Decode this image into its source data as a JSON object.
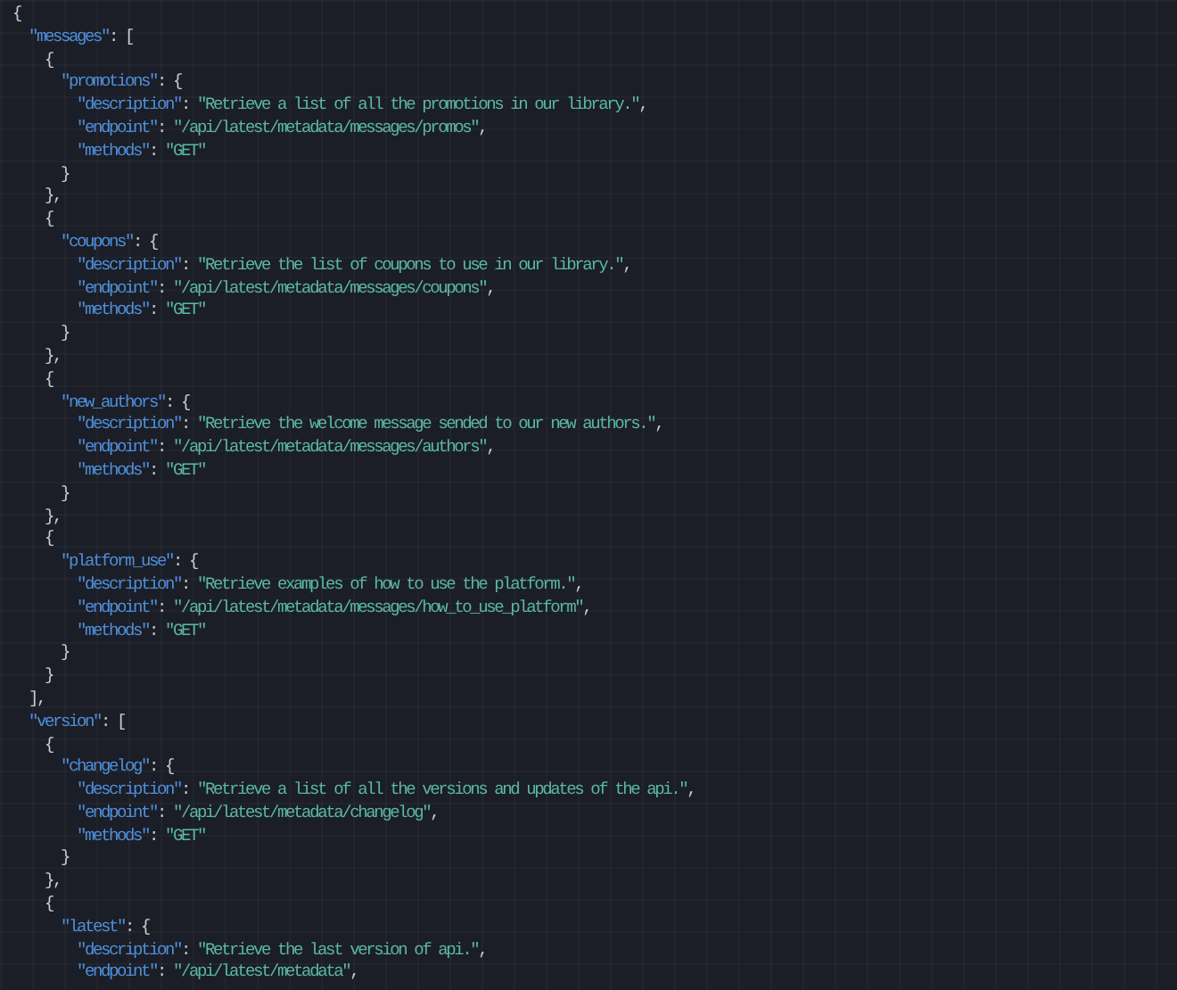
{
  "editor": {
    "lines": [
      [
        {
          "kind": "punct",
          "text": "{"
        }
      ],
      [
        {
          "kind": "key",
          "text": "  \"messages\""
        },
        {
          "kind": "punct",
          "text": ": ["
        }
      ],
      [
        {
          "kind": "punct",
          "text": "    {"
        }
      ],
      [
        {
          "kind": "key",
          "text": "      \"promotions\""
        },
        {
          "kind": "punct",
          "text": ": {"
        }
      ],
      [
        {
          "kind": "key",
          "text": "        \"description\""
        },
        {
          "kind": "punct",
          "text": ": "
        },
        {
          "kind": "string",
          "text": "\"Retrieve a list of all the promotions in our library.\""
        },
        {
          "kind": "punct",
          "text": ","
        }
      ],
      [
        {
          "kind": "key",
          "text": "        \"endpoint\""
        },
        {
          "kind": "punct",
          "text": ": "
        },
        {
          "kind": "string",
          "text": "\"/api/latest/metadata/messages/promos\""
        },
        {
          "kind": "punct",
          "text": ","
        }
      ],
      [
        {
          "kind": "key",
          "text": "        \"methods\""
        },
        {
          "kind": "punct",
          "text": ": "
        },
        {
          "kind": "string",
          "text": "\"GET\""
        }
      ],
      [
        {
          "kind": "punct",
          "text": "      }"
        }
      ],
      [
        {
          "kind": "punct",
          "text": "    },"
        }
      ],
      [
        {
          "kind": "punct",
          "text": "    {"
        }
      ],
      [
        {
          "kind": "key",
          "text": "      \"coupons\""
        },
        {
          "kind": "punct",
          "text": ": {"
        }
      ],
      [
        {
          "kind": "key",
          "text": "        \"description\""
        },
        {
          "kind": "punct",
          "text": ": "
        },
        {
          "kind": "string",
          "text": "\"Retrieve the list of coupons to use in our library.\""
        },
        {
          "kind": "punct",
          "text": ","
        }
      ],
      [
        {
          "kind": "key",
          "text": "        \"endpoint\""
        },
        {
          "kind": "punct",
          "text": ": "
        },
        {
          "kind": "string",
          "text": "\"/api/latest/metadata/messages/coupons\""
        },
        {
          "kind": "punct",
          "text": ","
        }
      ],
      [
        {
          "kind": "key",
          "text": "        \"methods\""
        },
        {
          "kind": "punct",
          "text": ": "
        },
        {
          "kind": "string",
          "text": "\"GET\""
        }
      ],
      [
        {
          "kind": "punct",
          "text": "      }"
        }
      ],
      [
        {
          "kind": "punct",
          "text": "    },"
        }
      ],
      [
        {
          "kind": "punct",
          "text": "    {"
        }
      ],
      [
        {
          "kind": "key",
          "text": "      \"new_authors\""
        },
        {
          "kind": "punct",
          "text": ": {"
        }
      ],
      [
        {
          "kind": "key",
          "text": "        \"description\""
        },
        {
          "kind": "punct",
          "text": ": "
        },
        {
          "kind": "string",
          "text": "\"Retrieve the welcome message sended to our new authors.\""
        },
        {
          "kind": "punct",
          "text": ","
        }
      ],
      [
        {
          "kind": "key",
          "text": "        \"endpoint\""
        },
        {
          "kind": "punct",
          "text": ": "
        },
        {
          "kind": "string",
          "text": "\"/api/latest/metadata/messages/authors\""
        },
        {
          "kind": "punct",
          "text": ","
        }
      ],
      [
        {
          "kind": "key",
          "text": "        \"methods\""
        },
        {
          "kind": "punct",
          "text": ": "
        },
        {
          "kind": "string",
          "text": "\"GET\""
        }
      ],
      [
        {
          "kind": "punct",
          "text": "      }"
        }
      ],
      [
        {
          "kind": "punct",
          "text": "    },"
        }
      ],
      [
        {
          "kind": "punct",
          "text": "    {"
        }
      ],
      [
        {
          "kind": "key",
          "text": "      \"platform_use\""
        },
        {
          "kind": "punct",
          "text": ": {"
        }
      ],
      [
        {
          "kind": "key",
          "text": "        \"description\""
        },
        {
          "kind": "punct",
          "text": ": "
        },
        {
          "kind": "string",
          "text": "\"Retrieve examples of how to use the platform.\""
        },
        {
          "kind": "punct",
          "text": ","
        }
      ],
      [
        {
          "kind": "key",
          "text": "        \"endpoint\""
        },
        {
          "kind": "punct",
          "text": ": "
        },
        {
          "kind": "string",
          "text": "\"/api/latest/metadata/messages/how_to_use_platform\""
        },
        {
          "kind": "punct",
          "text": ","
        }
      ],
      [
        {
          "kind": "key",
          "text": "        \"methods\""
        },
        {
          "kind": "punct",
          "text": ": "
        },
        {
          "kind": "string",
          "text": "\"GET\""
        }
      ],
      [
        {
          "kind": "punct",
          "text": "      }"
        }
      ],
      [
        {
          "kind": "punct",
          "text": "    }"
        }
      ],
      [
        {
          "kind": "punct",
          "text": "  ],"
        }
      ],
      [
        {
          "kind": "key",
          "text": "  \"version\""
        },
        {
          "kind": "punct",
          "text": ": ["
        }
      ],
      [
        {
          "kind": "punct",
          "text": "    {"
        }
      ],
      [
        {
          "kind": "key",
          "text": "      \"changelog\""
        },
        {
          "kind": "punct",
          "text": ": {"
        }
      ],
      [
        {
          "kind": "key",
          "text": "        \"description\""
        },
        {
          "kind": "punct",
          "text": ": "
        },
        {
          "kind": "string",
          "text": "\"Retrieve a list of all the versions and updates of the api.\""
        },
        {
          "kind": "punct",
          "text": ","
        }
      ],
      [
        {
          "kind": "key",
          "text": "        \"endpoint\""
        },
        {
          "kind": "punct",
          "text": ": "
        },
        {
          "kind": "string",
          "text": "\"/api/latest/metadata/changelog\""
        },
        {
          "kind": "punct",
          "text": ","
        }
      ],
      [
        {
          "kind": "key",
          "text": "        \"methods\""
        },
        {
          "kind": "punct",
          "text": ": "
        },
        {
          "kind": "string",
          "text": "\"GET\""
        }
      ],
      [
        {
          "kind": "punct",
          "text": "      }"
        }
      ],
      [
        {
          "kind": "punct",
          "text": "    },"
        }
      ],
      [
        {
          "kind": "punct",
          "text": "    {"
        }
      ],
      [
        {
          "kind": "key",
          "text": "      \"latest\""
        },
        {
          "kind": "punct",
          "text": ": {"
        }
      ],
      [
        {
          "kind": "key",
          "text": "        \"description\""
        },
        {
          "kind": "punct",
          "text": ": "
        },
        {
          "kind": "string",
          "text": "\"Retrieve the last version of api.\""
        },
        {
          "kind": "punct",
          "text": ","
        }
      ],
      [
        {
          "kind": "key",
          "text": "        \"endpoint\""
        },
        {
          "kind": "punct",
          "text": ": "
        },
        {
          "kind": "string",
          "text": "\"/api/latest/metadata\""
        },
        {
          "kind": "punct",
          "text": ","
        }
      ]
    ]
  }
}
